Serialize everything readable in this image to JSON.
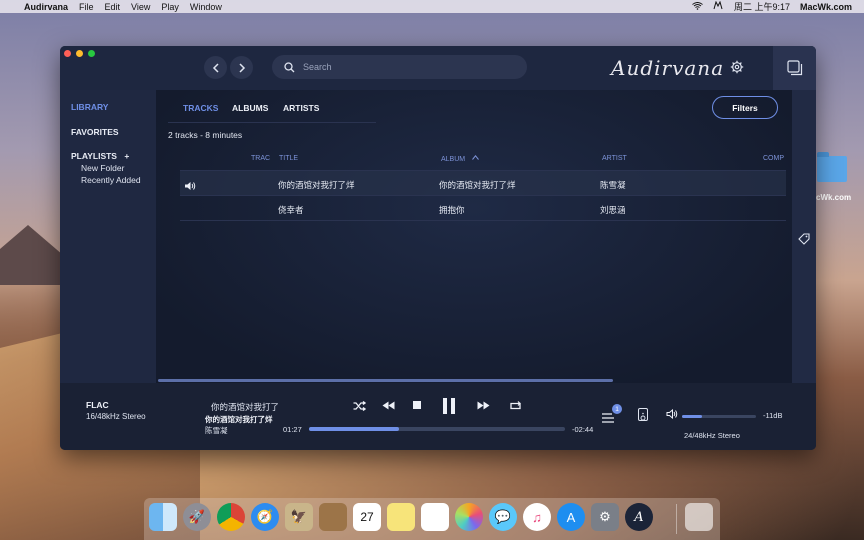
{
  "menubar": {
    "app": "Audirvana",
    "items": [
      "File",
      "Edit",
      "View",
      "Play",
      "Window"
    ],
    "clock": "周二 上午9:17",
    "site": "MacWk.com"
  },
  "desktop": {
    "folder_label": "cWk.com"
  },
  "toolbar": {
    "search_placeholder": "Search",
    "logo": "Audirvana"
  },
  "sidebar": {
    "library": "LIBRARY",
    "favorites": "FAVORITES",
    "playlists": "PLAYLISTS",
    "add": "+",
    "sub_items": [
      "New Folder",
      "Recently Added"
    ]
  },
  "tabs": [
    "TRACKS",
    "ALBUMS",
    "ARTISTS"
  ],
  "filters_label": "Filters",
  "count_text": "2 tracks - 8 minutes",
  "columns": {
    "track": "TRAC",
    "title": "TITLE",
    "album": "ALBUM",
    "artist": "ARTIST",
    "composer": "COMP"
  },
  "rows": [
    {
      "title": "你的酒馆对我打了烊",
      "album": "你的酒馆对我打了烊",
      "artist": "陈雪凝",
      "playing": true
    },
    {
      "title": "侥幸者",
      "album": "拥抱你",
      "artist": "刘思涵",
      "playing": false
    }
  ],
  "player": {
    "format": "FLAC",
    "rate": "16/48kHz Stereo",
    "title_scroll": "你的酒馆对我打了",
    "title": "你的酒馆对我打了烊",
    "artist": "陈雪凝",
    "elapsed": "01:27",
    "remaining": "-02:44",
    "progress": 0.35,
    "queue_count": "1",
    "volume": 0.27,
    "db": "-11dB",
    "output_format": "24/48kHz Stereo"
  },
  "colors": {
    "accent": "#6f8fe6",
    "window_bg": "#1b2438"
  },
  "dock": [
    "finder-icon",
    "launchpad-icon",
    "chrome-icon",
    "safari-icon",
    "mail-icon",
    "contacts-icon",
    "calendar-icon",
    "notes-icon",
    "reminders-icon",
    "photos-icon",
    "messages-icon",
    "itunes-icon",
    "app-store-icon",
    "system-preferences-icon",
    "audirvana-icon",
    "trash-icon"
  ],
  "calendar_day": "27"
}
